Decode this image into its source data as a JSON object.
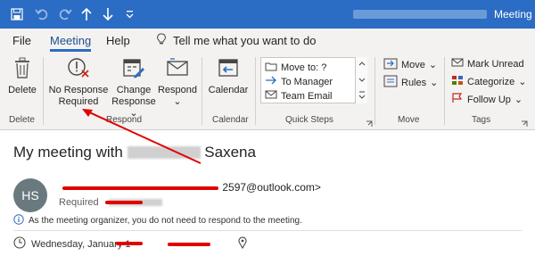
{
  "titlebar": {
    "title": "Meeting",
    "qat": [
      "save-icon",
      "undo-icon",
      "redo-icon",
      "arrow-up-icon",
      "arrow-down-icon",
      "customize-icon"
    ]
  },
  "menu": {
    "tabs": [
      "File",
      "Meeting",
      "Help"
    ],
    "active_tab": "Meeting",
    "tell_me": "Tell me what you want to do"
  },
  "ribbon": {
    "delete": {
      "label": "Delete",
      "group": "Delete"
    },
    "respond_group": {
      "group": "Respond",
      "no_response_line1": "No Response",
      "no_response_line2": "Required",
      "change_line1": "Change",
      "change_line2": "Response",
      "respond": "Respond"
    },
    "calendar": {
      "label": "Calendar",
      "group": "Calendar"
    },
    "quick_steps": {
      "group": "Quick Steps",
      "items": [
        "Move to: ?",
        "To Manager",
        "Team Email"
      ]
    },
    "move": {
      "group": "Move",
      "move": "Move",
      "rules": "Rules"
    },
    "tags": {
      "group": "Tags",
      "mark_unread": "Mark Unread",
      "categorize": "Categorize",
      "follow_up": "Follow Up"
    }
  },
  "message": {
    "subject_prefix": "My meeting with",
    "subject_suffix": "Saxena",
    "avatar": "HS",
    "from_tail": "2597@outlook.com>",
    "required": "Required",
    "info": "As the meeting organizer, you do not need to respond to the meeting.",
    "date": "Wednesday, January 1",
    "colors": {
      "accent": "#2b6cc4",
      "annotation": "#e00000"
    }
  }
}
